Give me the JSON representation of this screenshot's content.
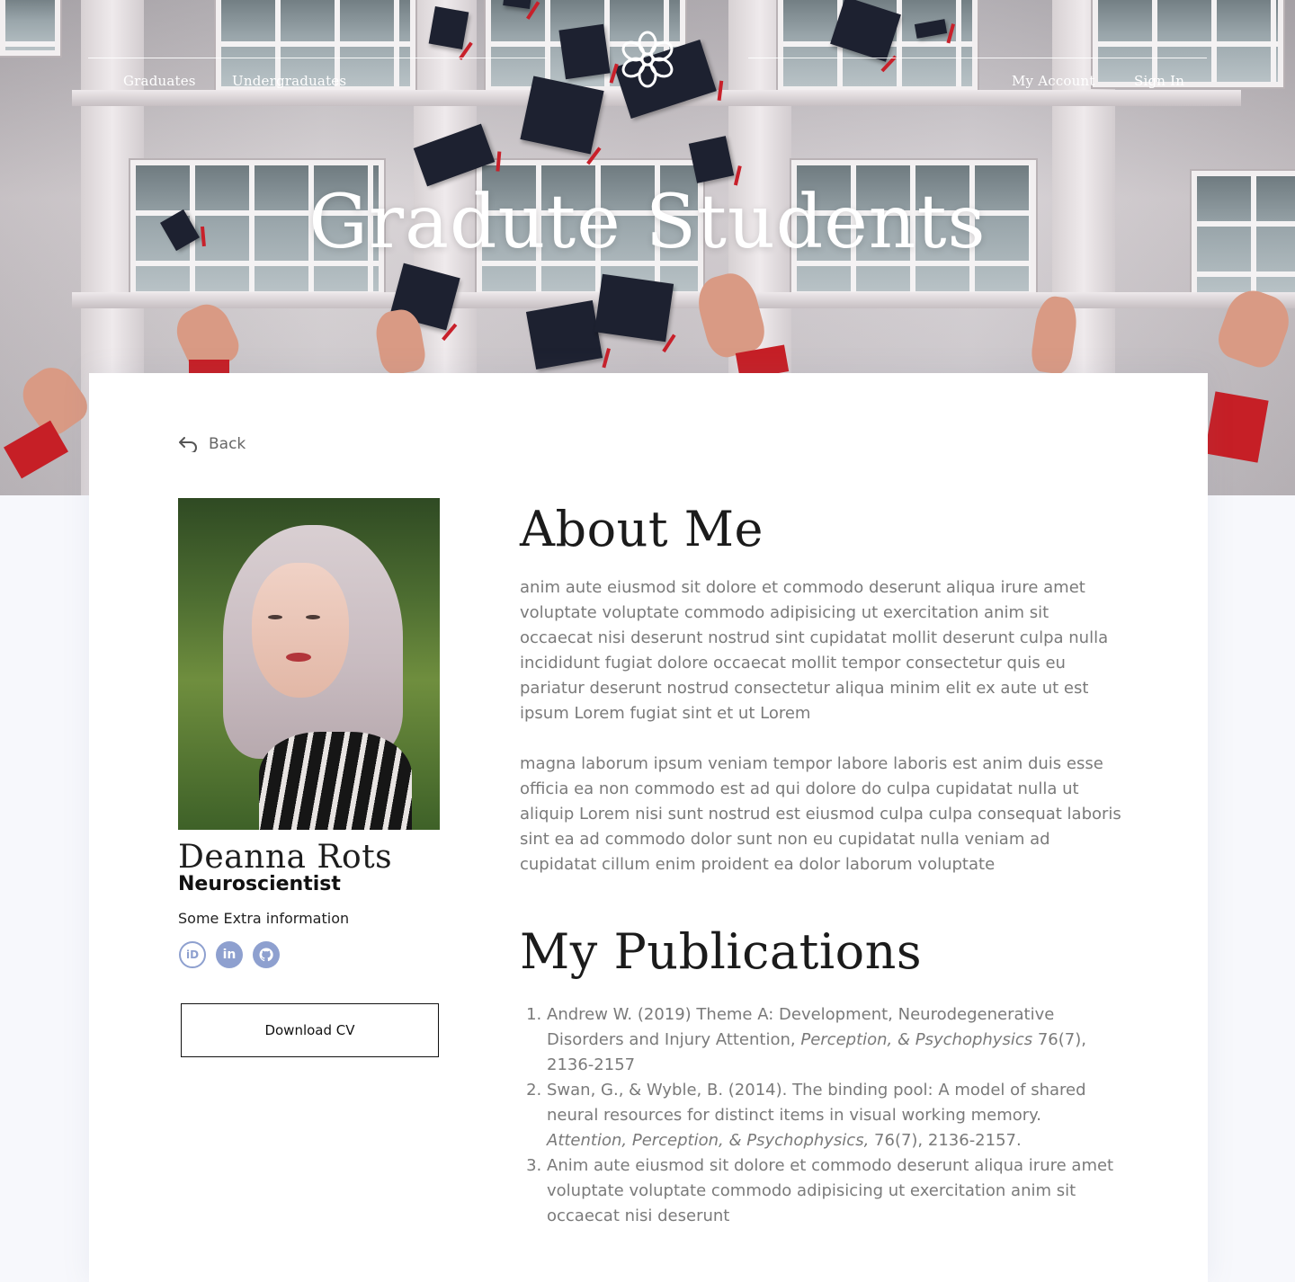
{
  "nav": {
    "left_links": [
      "Graduates",
      "Undergraduates"
    ],
    "right_links": [
      "My Account",
      "Sign In"
    ]
  },
  "hero": {
    "title": "Gradute Students"
  },
  "back": {
    "label": "Back"
  },
  "profile": {
    "name": "Deanna Rots",
    "role": "Neuroscientist",
    "extra": "Some Extra information",
    "socials": [
      "orcid-icon",
      "linkedin-icon",
      "github-icon"
    ],
    "download_label": "Download CV"
  },
  "about": {
    "title": "About Me",
    "paragraphs": [
      "anim aute eiusmod sit dolore et commodo deserunt aliqua irure amet voluptate voluptate commodo adipisicing ut exercitation anim sit occaecat nisi deserunt nostrud sint cupidatat mollit deserunt culpa nulla incididunt fugiat dolore occaecat mollit tempor consectetur quis eu pariatur deserunt nostrud consectetur aliqua minim elit ex aute ut est ipsum Lorem fugiat sint et ut Lorem",
      "magna laborum ipsum veniam tempor labore laboris est anim duis esse officia ea non commodo est ad qui dolore do culpa cupidatat nulla ut aliquip Lorem nisi sunt nostrud est eiusmod culpa culpa consequat laboris sint ea ad commodo dolor sunt non eu cupidatat nulla veniam ad cupidatat cillum enim proident ea dolor laborum voluptate"
    ]
  },
  "publications": {
    "title": "My Publications",
    "items": [
      {
        "before": "Andrew W. (2019) Theme A: Development, Neurodegenerative Disorders and Injury Attention, ",
        "italic": "Perception, & Psychophysics",
        "after": " 76(7), 2136-2157"
      },
      {
        "before": "Swan, G., & Wyble, B. (2014). The binding pool: A model of shared neural resources for distinct items in visual working memory. ",
        "italic": "Attention, Perception, & Psychophysics,",
        "after": " 76(7), 2136-2157."
      },
      {
        "before": "Anim aute eiusmod sit dolore et commodo deserunt aliqua irure amet voluptate voluptate commodo adipisicing ut exercitation anim sit occaecat nisi deserunt",
        "italic": "",
        "after": ""
      }
    ]
  },
  "colors": {
    "accent_icon": "#8ea0cf",
    "body_text": "#7a7a7a",
    "heading": "#1b1b1b"
  }
}
